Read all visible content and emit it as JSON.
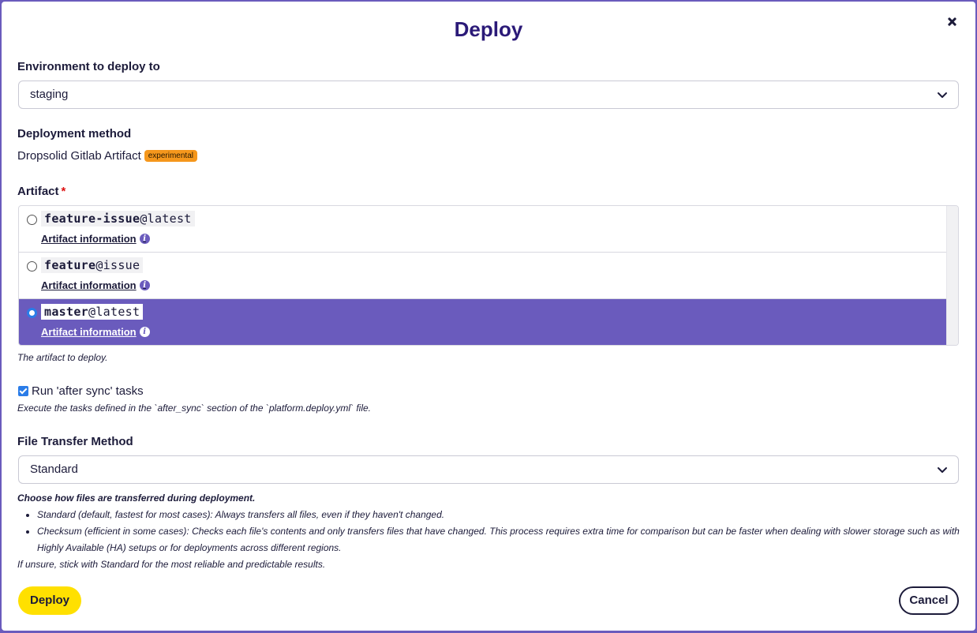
{
  "dialog": {
    "title": "Deploy"
  },
  "environment": {
    "label": "Environment to deploy to",
    "value": "staging"
  },
  "deployment_method": {
    "label": "Deployment method",
    "value": "Dropsolid Gitlab Artifact",
    "badge": "experimental"
  },
  "artifact": {
    "label": "Artifact",
    "required_mark": "*",
    "help": "The artifact to deploy.",
    "items": [
      {
        "name": "feature-issue",
        "suffix": "@latest",
        "info_label": "Artifact information",
        "selected": false
      },
      {
        "name": "feature",
        "suffix": "@issue",
        "info_label": "Artifact information",
        "selected": false
      },
      {
        "name": "master",
        "suffix": "@latest",
        "info_label": "Artifact information",
        "selected": true
      }
    ]
  },
  "after_sync": {
    "label": "Run 'after sync' tasks",
    "checked": true,
    "help": "Execute the tasks defined in the `after_sync` section of the `platform.deploy.yml` file."
  },
  "file_transfer": {
    "label": "File Transfer Method",
    "value": "Standard",
    "help_lead": "Choose how files are transferred during deployment.",
    "help_items": [
      "Standard (default, fastest for most cases): Always transfers all files, even if they haven't changed.",
      "Checksum (efficient in some cases): Checks each file's contents and only transfers files that have changed. This process requires extra time for comparison but can be faster when dealing with slower storage such as with Highly Available (HA) setups or for deployments across different regions."
    ],
    "help_footer": "If unsure, stick with Standard for the most reliable and predictable results."
  },
  "actions": {
    "deploy_label": "Deploy",
    "cancel_label": "Cancel"
  },
  "colors": {
    "accent": "#6a5bbd",
    "primary_button": "#ffe000",
    "badge": "#f5971c",
    "title": "#2b1a78"
  }
}
